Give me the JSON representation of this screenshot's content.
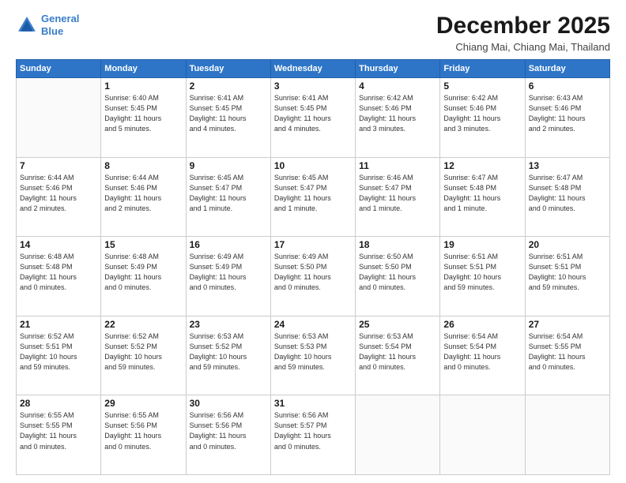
{
  "header": {
    "logo_line1": "General",
    "logo_line2": "Blue",
    "month": "December 2025",
    "location": "Chiang Mai, Chiang Mai, Thailand"
  },
  "weekdays": [
    "Sunday",
    "Monday",
    "Tuesday",
    "Wednesday",
    "Thursday",
    "Friday",
    "Saturday"
  ],
  "weeks": [
    [
      {
        "day": "",
        "info": ""
      },
      {
        "day": "1",
        "info": "Sunrise: 6:40 AM\nSunset: 5:45 PM\nDaylight: 11 hours\nand 5 minutes."
      },
      {
        "day": "2",
        "info": "Sunrise: 6:41 AM\nSunset: 5:45 PM\nDaylight: 11 hours\nand 4 minutes."
      },
      {
        "day": "3",
        "info": "Sunrise: 6:41 AM\nSunset: 5:45 PM\nDaylight: 11 hours\nand 4 minutes."
      },
      {
        "day": "4",
        "info": "Sunrise: 6:42 AM\nSunset: 5:46 PM\nDaylight: 11 hours\nand 3 minutes."
      },
      {
        "day": "5",
        "info": "Sunrise: 6:42 AM\nSunset: 5:46 PM\nDaylight: 11 hours\nand 3 minutes."
      },
      {
        "day": "6",
        "info": "Sunrise: 6:43 AM\nSunset: 5:46 PM\nDaylight: 11 hours\nand 2 minutes."
      }
    ],
    [
      {
        "day": "7",
        "info": "Sunrise: 6:44 AM\nSunset: 5:46 PM\nDaylight: 11 hours\nand 2 minutes."
      },
      {
        "day": "8",
        "info": "Sunrise: 6:44 AM\nSunset: 5:46 PM\nDaylight: 11 hours\nand 2 minutes."
      },
      {
        "day": "9",
        "info": "Sunrise: 6:45 AM\nSunset: 5:47 PM\nDaylight: 11 hours\nand 1 minute."
      },
      {
        "day": "10",
        "info": "Sunrise: 6:45 AM\nSunset: 5:47 PM\nDaylight: 11 hours\nand 1 minute."
      },
      {
        "day": "11",
        "info": "Sunrise: 6:46 AM\nSunset: 5:47 PM\nDaylight: 11 hours\nand 1 minute."
      },
      {
        "day": "12",
        "info": "Sunrise: 6:47 AM\nSunset: 5:48 PM\nDaylight: 11 hours\nand 1 minute."
      },
      {
        "day": "13",
        "info": "Sunrise: 6:47 AM\nSunset: 5:48 PM\nDaylight: 11 hours\nand 0 minutes."
      }
    ],
    [
      {
        "day": "14",
        "info": "Sunrise: 6:48 AM\nSunset: 5:48 PM\nDaylight: 11 hours\nand 0 minutes."
      },
      {
        "day": "15",
        "info": "Sunrise: 6:48 AM\nSunset: 5:49 PM\nDaylight: 11 hours\nand 0 minutes."
      },
      {
        "day": "16",
        "info": "Sunrise: 6:49 AM\nSunset: 5:49 PM\nDaylight: 11 hours\nand 0 minutes."
      },
      {
        "day": "17",
        "info": "Sunrise: 6:49 AM\nSunset: 5:50 PM\nDaylight: 11 hours\nand 0 minutes."
      },
      {
        "day": "18",
        "info": "Sunrise: 6:50 AM\nSunset: 5:50 PM\nDaylight: 11 hours\nand 0 minutes."
      },
      {
        "day": "19",
        "info": "Sunrise: 6:51 AM\nSunset: 5:51 PM\nDaylight: 10 hours\nand 59 minutes."
      },
      {
        "day": "20",
        "info": "Sunrise: 6:51 AM\nSunset: 5:51 PM\nDaylight: 10 hours\nand 59 minutes."
      }
    ],
    [
      {
        "day": "21",
        "info": "Sunrise: 6:52 AM\nSunset: 5:51 PM\nDaylight: 10 hours\nand 59 minutes."
      },
      {
        "day": "22",
        "info": "Sunrise: 6:52 AM\nSunset: 5:52 PM\nDaylight: 10 hours\nand 59 minutes."
      },
      {
        "day": "23",
        "info": "Sunrise: 6:53 AM\nSunset: 5:52 PM\nDaylight: 10 hours\nand 59 minutes."
      },
      {
        "day": "24",
        "info": "Sunrise: 6:53 AM\nSunset: 5:53 PM\nDaylight: 10 hours\nand 59 minutes."
      },
      {
        "day": "25",
        "info": "Sunrise: 6:53 AM\nSunset: 5:54 PM\nDaylight: 11 hours\nand 0 minutes."
      },
      {
        "day": "26",
        "info": "Sunrise: 6:54 AM\nSunset: 5:54 PM\nDaylight: 11 hours\nand 0 minutes."
      },
      {
        "day": "27",
        "info": "Sunrise: 6:54 AM\nSunset: 5:55 PM\nDaylight: 11 hours\nand 0 minutes."
      }
    ],
    [
      {
        "day": "28",
        "info": "Sunrise: 6:55 AM\nSunset: 5:55 PM\nDaylight: 11 hours\nand 0 minutes."
      },
      {
        "day": "29",
        "info": "Sunrise: 6:55 AM\nSunset: 5:56 PM\nDaylight: 11 hours\nand 0 minutes."
      },
      {
        "day": "30",
        "info": "Sunrise: 6:56 AM\nSunset: 5:56 PM\nDaylight: 11 hours\nand 0 minutes."
      },
      {
        "day": "31",
        "info": "Sunrise: 6:56 AM\nSunset: 5:57 PM\nDaylight: 11 hours\nand 0 minutes."
      },
      {
        "day": "",
        "info": ""
      },
      {
        "day": "",
        "info": ""
      },
      {
        "day": "",
        "info": ""
      }
    ]
  ]
}
